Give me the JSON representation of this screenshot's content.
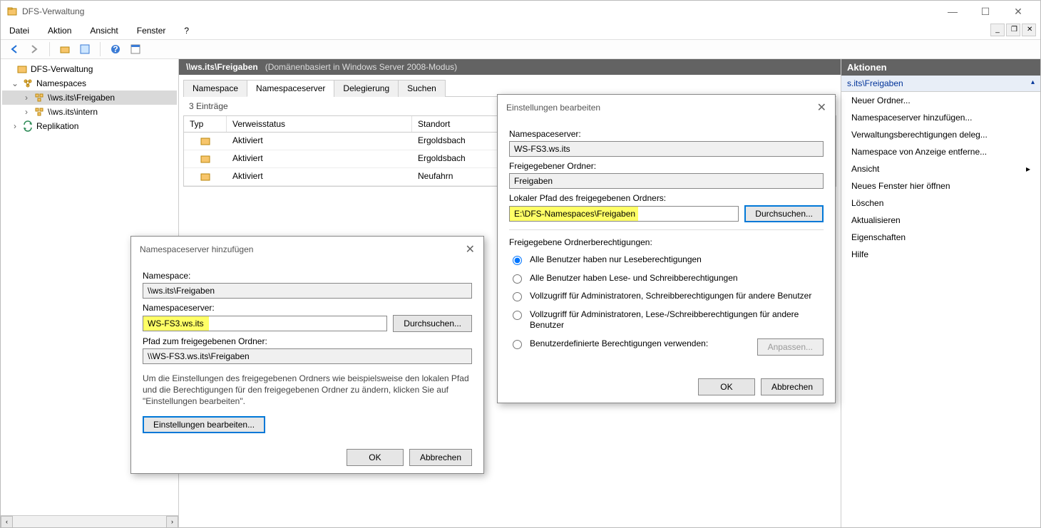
{
  "window": {
    "title": "DFS-Verwaltung"
  },
  "menu": {
    "items": [
      "Datei",
      "Aktion",
      "Ansicht",
      "Fenster",
      "?"
    ]
  },
  "tree": {
    "root": "DFS-Verwaltung",
    "namespaces": "Namespaces",
    "ns1": "\\\\ws.its\\Freigaben",
    "ns2": "\\\\ws.its\\intern",
    "replication": "Replikation"
  },
  "path_header": {
    "path": "\\\\ws.its\\Freigaben",
    "sub": "(Domänenbasiert in Windows Server 2008-Modus)"
  },
  "tabs": [
    "Namespace",
    "Namespaceserver",
    "Delegierung",
    "Suchen"
  ],
  "entry_count": "3 Einträge",
  "grid": {
    "headers": {
      "typ": "Typ",
      "status": "Verweisstatus",
      "loc": "Standort"
    },
    "rows": [
      {
        "status": "Aktiviert",
        "loc": "Ergoldsbach"
      },
      {
        "status": "Aktiviert",
        "loc": "Ergoldsbach"
      },
      {
        "status": "Aktiviert",
        "loc": "Neufahrn"
      }
    ]
  },
  "actions": {
    "title": "Aktionen",
    "subhead": "s.its\\Freigaben",
    "items": [
      "Neuer Ordner...",
      "Namespaceserver hinzufügen...",
      "Verwaltungsberechtigungen deleg...",
      "Namespace von Anzeige entferne...",
      "Ansicht",
      "Neues Fenster hier öffnen",
      "Löschen",
      "Aktualisieren",
      "Eigenschaften",
      "Hilfe"
    ]
  },
  "dialog1": {
    "title": "Namespaceserver hinzufügen",
    "namespace_label": "Namespace:",
    "namespace_value": "\\\\ws.its\\Freigaben",
    "server_label": "Namespaceserver:",
    "server_value": "WS-FS3.ws.its",
    "browse": "Durchsuchen...",
    "path_label": "Pfad zum freigegebenen Ordner:",
    "path_value": "\\\\WS-FS3.ws.its\\Freigaben",
    "hint": "Um die Einstellungen des freigegebenen Ordners wie beispielsweise den lokalen Pfad und die Berechtigungen für den freigegebenen Ordner zu ändern, klicken Sie auf \"Einstellungen bearbeiten\".",
    "edit_btn": "Einstellungen bearbeiten...",
    "ok": "OK",
    "cancel": "Abbrechen"
  },
  "dialog2": {
    "title": "Einstellungen bearbeiten",
    "server_label": "Namespaceserver:",
    "server_value": "WS-FS3.ws.its",
    "share_label": "Freigegebener Ordner:",
    "share_value": "Freigaben",
    "local_label": "Lokaler Pfad des freigegebenen Ordners:",
    "local_value": "E:\\DFS-Namespaces\\Freigaben",
    "browse": "Durchsuchen...",
    "perm_heading": "Freigegebene Ordnerberechtigungen:",
    "radios": [
      "Alle Benutzer haben nur Leseberechtigungen",
      "Alle Benutzer haben Lese- und Schreibberechtigungen",
      "Vollzugriff für Administratoren, Schreibberechtigungen für andere Benutzer",
      "Vollzugriff für Administratoren, Lese-/Schreibberechtigungen für andere Benutzer",
      "Benutzerdefinierte Berechtigungen verwenden:"
    ],
    "customize": "Anpassen...",
    "ok": "OK",
    "cancel": "Abbrechen"
  }
}
